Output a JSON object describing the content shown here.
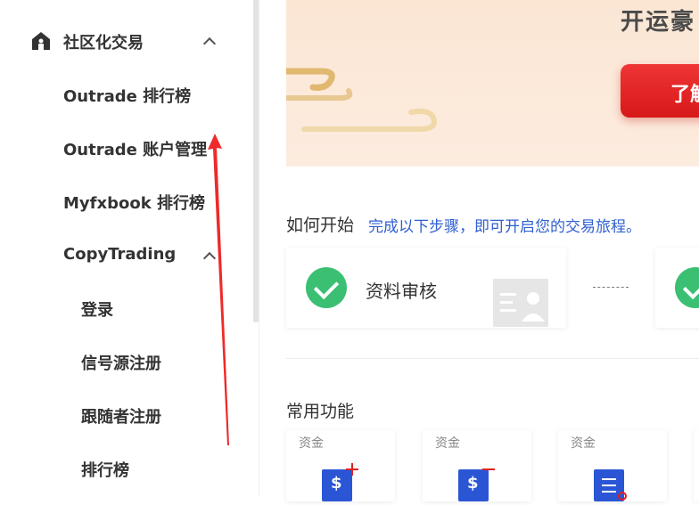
{
  "sidebar": {
    "items": [
      {
        "label": "社区化交易"
      },
      {
        "label": "Outrade 排行榜"
      },
      {
        "label": "Outrade 账户管理"
      },
      {
        "label": "Myfxbook 排行榜"
      },
      {
        "label": "CopyTrading"
      },
      {
        "label": "登录"
      },
      {
        "label": "信号源注册"
      },
      {
        "label": "跟随者注册"
      },
      {
        "label": "排行榜"
      }
    ]
  },
  "banner": {
    "title": "开运豪",
    "button_label": "了解"
  },
  "howto": {
    "title": "如何开始",
    "link": "完成以下步骤，即可开启您的交易旅程。",
    "steps": [
      {
        "label": "资料审核"
      }
    ]
  },
  "common": {
    "title": "常用功能",
    "cards": [
      {
        "tag": "资金"
      },
      {
        "tag": "资金"
      },
      {
        "tag": "资金"
      }
    ]
  },
  "colors": {
    "accent_red": "#e02020",
    "link_blue": "#2f5fd0",
    "success_green": "#3bbf73",
    "icon_blue": "#2a56d6"
  }
}
